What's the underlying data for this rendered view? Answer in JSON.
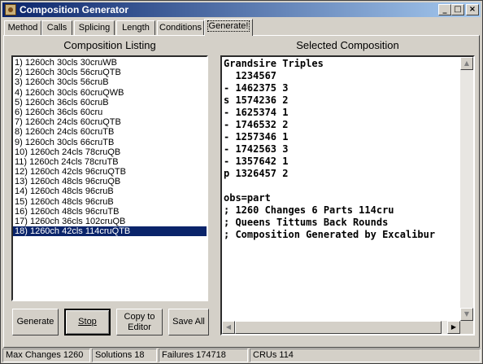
{
  "window": {
    "title": "Composition Generator"
  },
  "tabs": [
    {
      "label": "Method"
    },
    {
      "label": "Calls"
    },
    {
      "label": "Splicing"
    },
    {
      "label": "Length"
    },
    {
      "label": "Conditions"
    },
    {
      "label": "Generate!"
    }
  ],
  "left": {
    "heading": "Composition Listing",
    "items": [
      "1) 1260ch 30cls 30cruWB",
      "2) 1260ch 30cls 56cruQTB",
      "3) 1260ch 30cls 56cruB",
      "4) 1260ch 30cls 60cruQWB",
      "5) 1260ch 36cls 60cruB",
      "6) 1260ch 36cls 60cru",
      "7) 1260ch 24cls 60cruQTB",
      "8) 1260ch 24cls 60cruTB",
      "9) 1260ch 30cls 66cruTB",
      "10) 1260ch 24cls 78cruQB",
      "11) 1260ch 24cls 78cruTB",
      "12) 1260ch 42cls 96cruQTB",
      "13) 1260ch 48cls 96cruQB",
      "14) 1260ch 48cls 96cruB",
      "15) 1260ch 48cls 96cruB",
      "16) 1260ch 48cls 96cruTB",
      "17) 1260ch 36cls 102cruQB",
      "18) 1260ch 42cls 114cruQTB"
    ],
    "selected_index": 17
  },
  "right": {
    "heading": "Selected Composition",
    "lines": [
      "Grandsire Triples",
      "  1234567",
      "- 1462375 3",
      "s 1574236 2",
      "- 1625374 1",
      "- 1746532 2",
      "- 1257346 1",
      "- 1742563 3",
      "- 1357642 1",
      "p 1326457 2",
      "",
      "obs=part",
      "; 1260 Changes 6 Parts 114cru",
      "; Queens Tittums Back Rounds",
      "; Composition Generated by Excalibur"
    ]
  },
  "buttons": {
    "generate": "Generate",
    "stop": "Stop",
    "copy_to_editor_1": "Copy to",
    "copy_to_editor_2": "Editor",
    "save_all": "Save All"
  },
  "status": {
    "max_changes": "Max Changes 1260",
    "solutions": "Solutions 18",
    "failures": "Failures  174718",
    "crus": "CRUs 114"
  },
  "scroll_icons": [
    "arrow-up-icon",
    "arrow-down-icon",
    "arrow-left-icon",
    "arrow-right-icon"
  ]
}
